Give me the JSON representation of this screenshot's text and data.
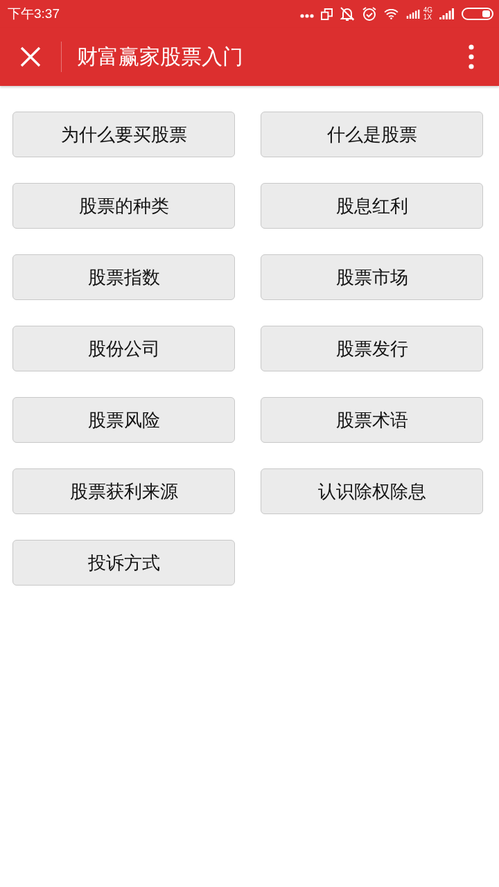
{
  "status_bar": {
    "time": "下午3:37",
    "network_labels": [
      "4G",
      "1X"
    ]
  },
  "header": {
    "title": "财富赢家股票入门"
  },
  "topics": [
    {
      "label": "为什么要买股票"
    },
    {
      "label": "什么是股票"
    },
    {
      "label": "股票的种类"
    },
    {
      "label": "股息红利"
    },
    {
      "label": "股票指数"
    },
    {
      "label": "股票市场"
    },
    {
      "label": "股份公司"
    },
    {
      "label": "股票发行"
    },
    {
      "label": "股票风险"
    },
    {
      "label": "股票术语"
    },
    {
      "label": "股票获利来源"
    },
    {
      "label": "认识除权除息"
    },
    {
      "label": "投诉方式"
    }
  ]
}
